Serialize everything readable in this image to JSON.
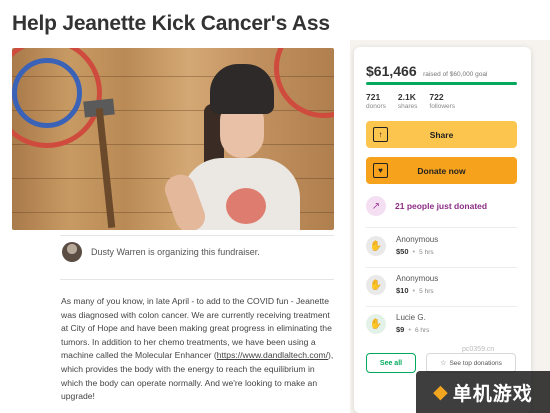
{
  "campaign": {
    "title": "Help Jeanette Kick Cancer's Ass",
    "organizer_text": "Dusty Warren is organizing this fundraiser.",
    "story": {
      "before_link": "As many of you know, in late April - to add to the COVID fun - Jeanette was diagnosed with colon cancer. We are currently receiving treatment at City of Hope and have been making great progress in eliminating the tumors. In addition to her chemo treatments, we have been using a machine called the Molecular Enhancer (",
      "link": "https://www.dandlaltech.com/",
      "after_link": "), which provides the body with the energy to reach the equilibrium in which the body can operate normally. And we're looking to make an upgrade!"
    }
  },
  "donation_card": {
    "raised_amount": "$61,466",
    "goal_text": "raised of $60,000 goal",
    "progress_fraction": 1.0,
    "stats": [
      {
        "value": "721",
        "label": "donors"
      },
      {
        "value": "2.1K",
        "label": "shares"
      },
      {
        "value": "722",
        "label": "followers"
      }
    ],
    "share_label": "Share",
    "donate_label": "Donate now",
    "donating_now": "21 people just donated",
    "donors": [
      {
        "name": "Anonymous",
        "amount": "$50",
        "time": "5 hrs",
        "icon": "anonymous-donor-icon"
      },
      {
        "name": "Anonymous",
        "amount": "$10",
        "time": "5 hrs",
        "icon": "anonymous-donor-icon"
      },
      {
        "name": "Lucie G.",
        "amount": "$9",
        "time": "6 hrs",
        "icon": "donor-icon"
      }
    ],
    "see_all_label": "See all",
    "see_top_label": "See top donations",
    "colors": {
      "accent": "#02a95c",
      "share": "#fbc54e",
      "donate": "#f7a21c",
      "trend": "#8c2d85"
    }
  },
  "watermark": {
    "url": "pc0359.cn",
    "brand": "单机游戏"
  }
}
